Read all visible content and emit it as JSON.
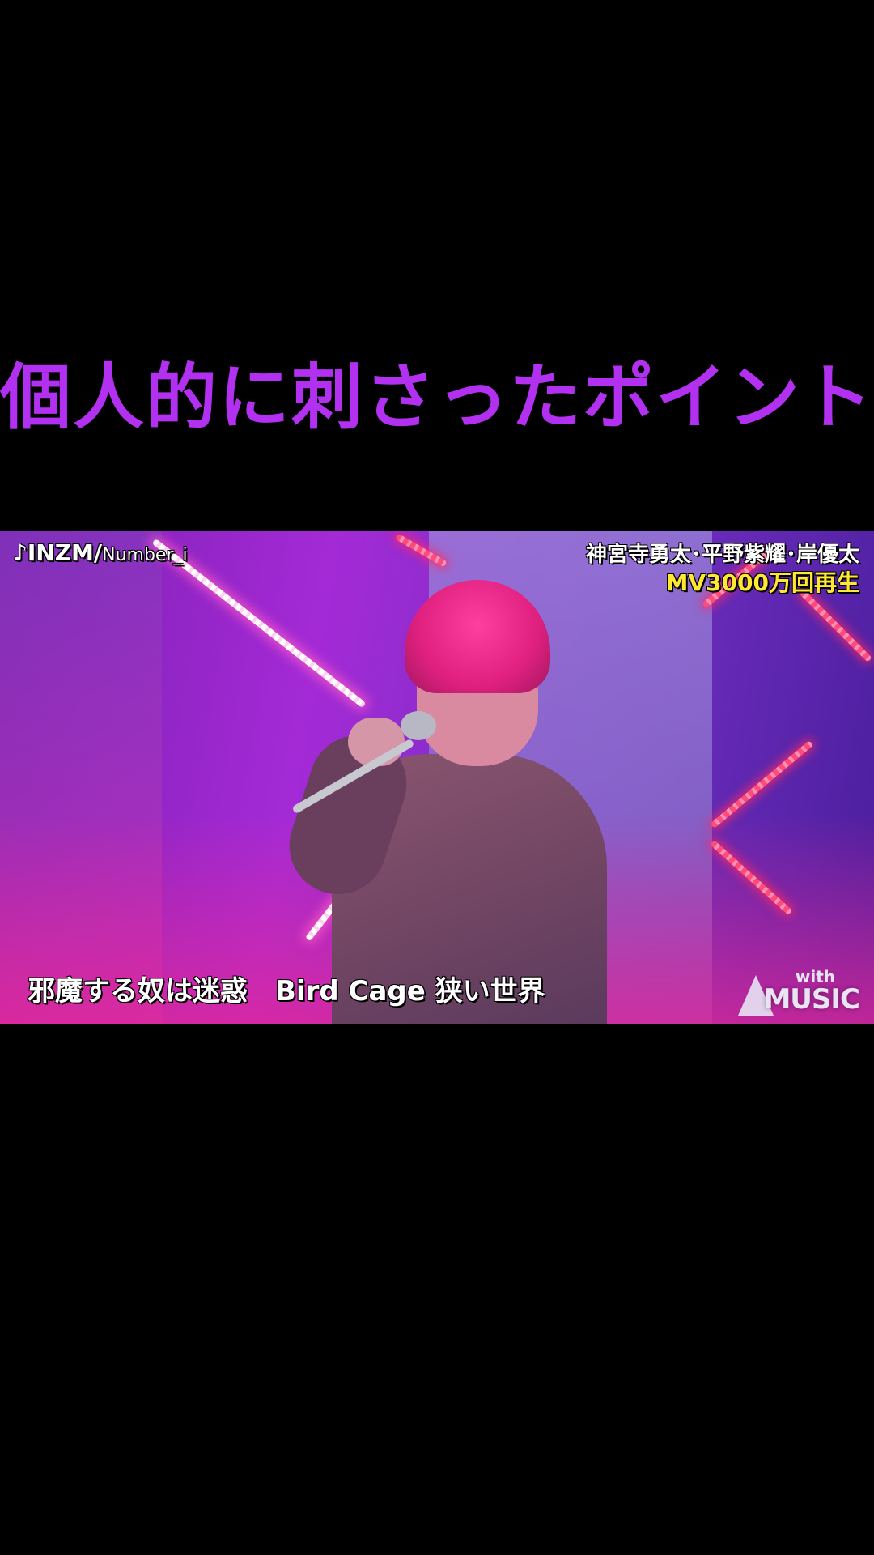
{
  "caption": {
    "title": "個人的に刺さったポイント"
  },
  "video": {
    "song_title": "♪INZM/",
    "artist": "Number_i",
    "members": "神宮寺勇太･平野紫耀･岸優太",
    "views_badge": "MV3000万回再生",
    "lyric": "邪魔する奴は迷惑　Bird Cage 狭い世界",
    "logo_top": "with",
    "logo_main": "MUSIC"
  },
  "colors": {
    "caption": "#b230f0",
    "views_badge": "#ffe832",
    "background": "#000000"
  }
}
